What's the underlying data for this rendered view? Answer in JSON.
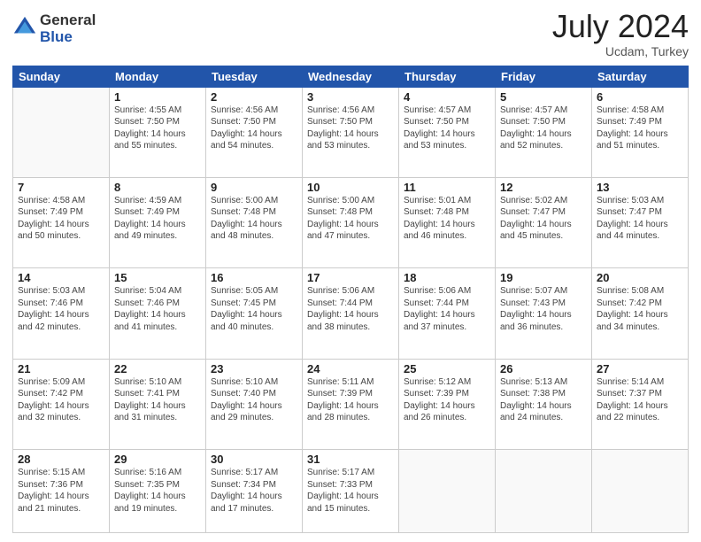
{
  "logo": {
    "general": "General",
    "blue": "Blue"
  },
  "title": {
    "month_year": "July 2024",
    "location": "Ucdam, Turkey"
  },
  "weekdays": [
    "Sunday",
    "Monday",
    "Tuesday",
    "Wednesday",
    "Thursday",
    "Friday",
    "Saturday"
  ],
  "weeks": [
    [
      {
        "day": "",
        "info": ""
      },
      {
        "day": "1",
        "info": "Sunrise: 4:55 AM\nSunset: 7:50 PM\nDaylight: 14 hours\nand 55 minutes."
      },
      {
        "day": "2",
        "info": "Sunrise: 4:56 AM\nSunset: 7:50 PM\nDaylight: 14 hours\nand 54 minutes."
      },
      {
        "day": "3",
        "info": "Sunrise: 4:56 AM\nSunset: 7:50 PM\nDaylight: 14 hours\nand 53 minutes."
      },
      {
        "day": "4",
        "info": "Sunrise: 4:57 AM\nSunset: 7:50 PM\nDaylight: 14 hours\nand 53 minutes."
      },
      {
        "day": "5",
        "info": "Sunrise: 4:57 AM\nSunset: 7:50 PM\nDaylight: 14 hours\nand 52 minutes."
      },
      {
        "day": "6",
        "info": "Sunrise: 4:58 AM\nSunset: 7:49 PM\nDaylight: 14 hours\nand 51 minutes."
      }
    ],
    [
      {
        "day": "7",
        "info": "Sunrise: 4:58 AM\nSunset: 7:49 PM\nDaylight: 14 hours\nand 50 minutes."
      },
      {
        "day": "8",
        "info": "Sunrise: 4:59 AM\nSunset: 7:49 PM\nDaylight: 14 hours\nand 49 minutes."
      },
      {
        "day": "9",
        "info": "Sunrise: 5:00 AM\nSunset: 7:48 PM\nDaylight: 14 hours\nand 48 minutes."
      },
      {
        "day": "10",
        "info": "Sunrise: 5:00 AM\nSunset: 7:48 PM\nDaylight: 14 hours\nand 47 minutes."
      },
      {
        "day": "11",
        "info": "Sunrise: 5:01 AM\nSunset: 7:48 PM\nDaylight: 14 hours\nand 46 minutes."
      },
      {
        "day": "12",
        "info": "Sunrise: 5:02 AM\nSunset: 7:47 PM\nDaylight: 14 hours\nand 45 minutes."
      },
      {
        "day": "13",
        "info": "Sunrise: 5:03 AM\nSunset: 7:47 PM\nDaylight: 14 hours\nand 44 minutes."
      }
    ],
    [
      {
        "day": "14",
        "info": "Sunrise: 5:03 AM\nSunset: 7:46 PM\nDaylight: 14 hours\nand 42 minutes."
      },
      {
        "day": "15",
        "info": "Sunrise: 5:04 AM\nSunset: 7:46 PM\nDaylight: 14 hours\nand 41 minutes."
      },
      {
        "day": "16",
        "info": "Sunrise: 5:05 AM\nSunset: 7:45 PM\nDaylight: 14 hours\nand 40 minutes."
      },
      {
        "day": "17",
        "info": "Sunrise: 5:06 AM\nSunset: 7:44 PM\nDaylight: 14 hours\nand 38 minutes."
      },
      {
        "day": "18",
        "info": "Sunrise: 5:06 AM\nSunset: 7:44 PM\nDaylight: 14 hours\nand 37 minutes."
      },
      {
        "day": "19",
        "info": "Sunrise: 5:07 AM\nSunset: 7:43 PM\nDaylight: 14 hours\nand 36 minutes."
      },
      {
        "day": "20",
        "info": "Sunrise: 5:08 AM\nSunset: 7:42 PM\nDaylight: 14 hours\nand 34 minutes."
      }
    ],
    [
      {
        "day": "21",
        "info": "Sunrise: 5:09 AM\nSunset: 7:42 PM\nDaylight: 14 hours\nand 32 minutes."
      },
      {
        "day": "22",
        "info": "Sunrise: 5:10 AM\nSunset: 7:41 PM\nDaylight: 14 hours\nand 31 minutes."
      },
      {
        "day": "23",
        "info": "Sunrise: 5:10 AM\nSunset: 7:40 PM\nDaylight: 14 hours\nand 29 minutes."
      },
      {
        "day": "24",
        "info": "Sunrise: 5:11 AM\nSunset: 7:39 PM\nDaylight: 14 hours\nand 28 minutes."
      },
      {
        "day": "25",
        "info": "Sunrise: 5:12 AM\nSunset: 7:39 PM\nDaylight: 14 hours\nand 26 minutes."
      },
      {
        "day": "26",
        "info": "Sunrise: 5:13 AM\nSunset: 7:38 PM\nDaylight: 14 hours\nand 24 minutes."
      },
      {
        "day": "27",
        "info": "Sunrise: 5:14 AM\nSunset: 7:37 PM\nDaylight: 14 hours\nand 22 minutes."
      }
    ],
    [
      {
        "day": "28",
        "info": "Sunrise: 5:15 AM\nSunset: 7:36 PM\nDaylight: 14 hours\nand 21 minutes."
      },
      {
        "day": "29",
        "info": "Sunrise: 5:16 AM\nSunset: 7:35 PM\nDaylight: 14 hours\nand 19 minutes."
      },
      {
        "day": "30",
        "info": "Sunrise: 5:17 AM\nSunset: 7:34 PM\nDaylight: 14 hours\nand 17 minutes."
      },
      {
        "day": "31",
        "info": "Sunrise: 5:17 AM\nSunset: 7:33 PM\nDaylight: 14 hours\nand 15 minutes."
      },
      {
        "day": "",
        "info": ""
      },
      {
        "day": "",
        "info": ""
      },
      {
        "day": "",
        "info": ""
      }
    ]
  ]
}
